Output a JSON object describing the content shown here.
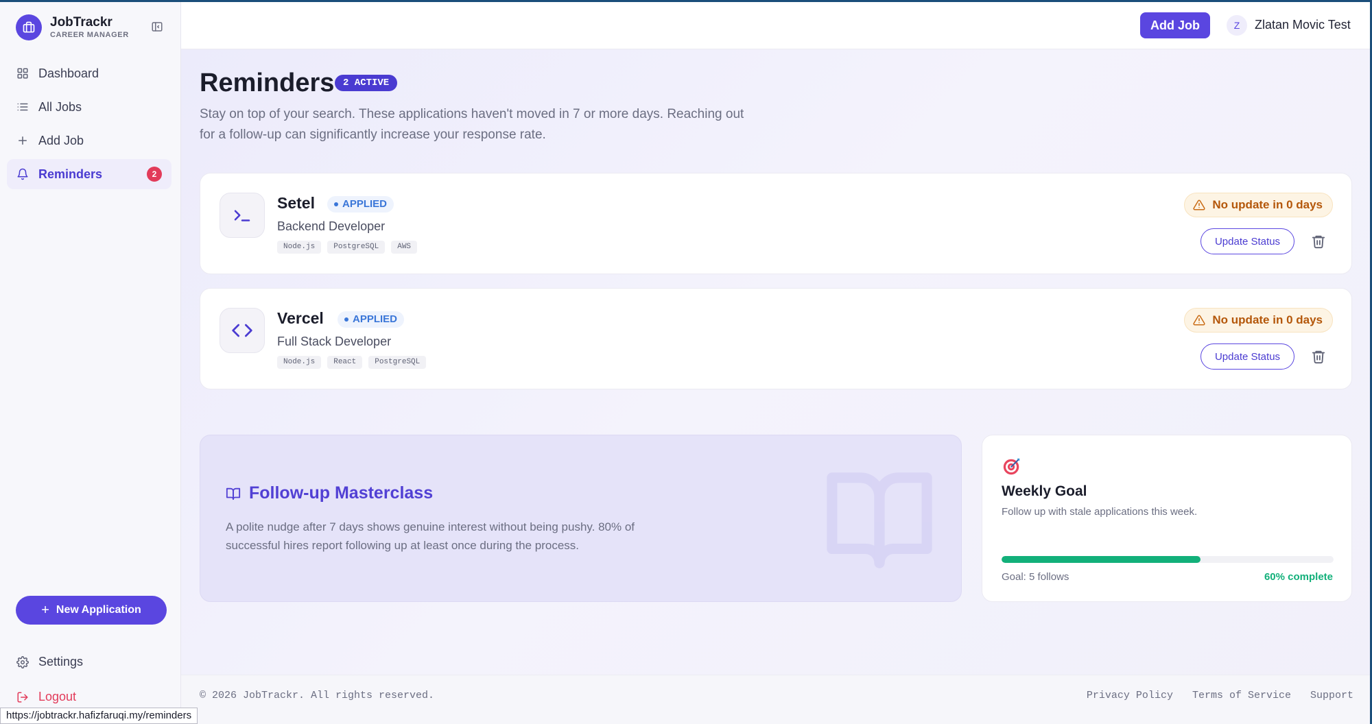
{
  "brand": {
    "name": "JobTrackr",
    "subtitle": "CAREER MANAGER",
    "logo_icon": "briefcase-icon"
  },
  "sidebar": {
    "items": [
      {
        "label": "Dashboard",
        "icon": "grid-icon"
      },
      {
        "label": "All Jobs",
        "icon": "list-icon"
      },
      {
        "label": "Add Job",
        "icon": "plus-icon"
      },
      {
        "label": "Reminders",
        "icon": "bell-icon",
        "badge": "2",
        "active": true
      }
    ],
    "new_application_label": "New Application",
    "settings_label": "Settings",
    "logout_label": "Logout"
  },
  "header": {
    "add_job_label": "Add Job",
    "user": {
      "initial": "Z",
      "name": "Zlatan Movic Test"
    }
  },
  "page": {
    "title": "Reminders",
    "active_badge": "2 ACTIVE",
    "description": "Stay on top of your search. These applications haven't moved in 7 or more days. Reaching out for a follow-up can significantly increase your response rate."
  },
  "jobs": [
    {
      "company": "Setel",
      "status": "APPLIED",
      "role": "Backend Developer",
      "tags": [
        "Node.js",
        "PostgreSQL",
        "AWS"
      ],
      "icon": "terminal-icon",
      "stale_text": "No update in 0 days",
      "update_label": "Update Status"
    },
    {
      "company": "Vercel",
      "status": "APPLIED",
      "role": "Full Stack Developer",
      "tags": [
        "Node.js",
        "React",
        "PostgreSQL"
      ],
      "icon": "code-icon",
      "stale_text": "No update in 0 days",
      "update_label": "Update Status"
    }
  ],
  "masterclass": {
    "title": "Follow-up Masterclass",
    "text": "A polite nudge after 7 days shows genuine interest without being pushy. 80% of successful hires report following up at least once during the process."
  },
  "weekly_goal": {
    "title": "Weekly Goal",
    "description": "Follow up with stale applications this week.",
    "goal_label": "Goal: 5 follows",
    "progress_percent": 60,
    "progress_label": "60% complete"
  },
  "footer": {
    "copyright": "© 2026 JobTrackr. All rights reserved.",
    "links": [
      "Privacy Policy",
      "Terms of Service",
      "Support"
    ]
  },
  "status_bar_url": "https://jobtrackr.hafizfaruqi.my/reminders",
  "colors": {
    "accent": "#5a46e0",
    "applied": "#3a76d8",
    "warning": "#b4570a",
    "success": "#12b07a",
    "danger": "#e23b5a"
  }
}
